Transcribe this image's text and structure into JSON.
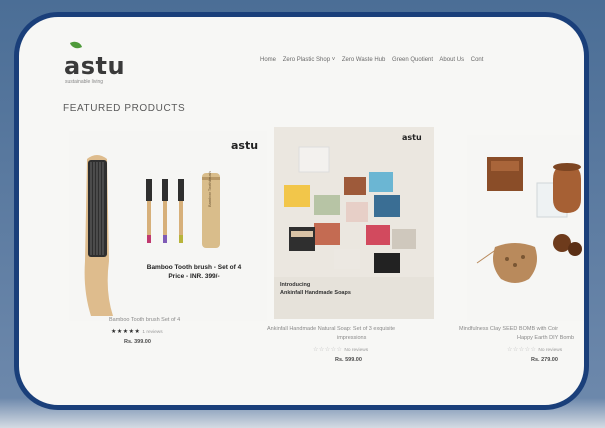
{
  "header": {
    "logo": "astu",
    "logo_sub": "sustainable living",
    "nav": [
      "Home",
      "Zero Plastic Shop ˅",
      "Zero Waste Hub",
      "Green Quotient",
      "About Us",
      "Cont"
    ]
  },
  "featured_title": "FEATURED PRODUCTS",
  "products": [
    {
      "brand": "astu",
      "overlay": "Bamboo Tooth brush - Set of 4\nPrice - INR. 399/-",
      "tube_label": "Bamboo Toothbrush",
      "name": "Bamboo Tooth brush Set of 4",
      "stars": "★★★★★",
      "reviews": "1 reviews",
      "price": "Rs. 399.00"
    },
    {
      "brand": "astu",
      "overlay": "Introducing\nAnkinfall Handmade Soaps",
      "name": "Ankinfall Handmade Natural Soap: Set of 3 exquisite",
      "name2": "impressions",
      "stars": "☆☆☆☆☆",
      "reviews": "No reviews",
      "price": "Rs. 599.00"
    },
    {
      "name": "Mindfulness Clay SEED BOMB with Coir",
      "name2": "Happy Earth DIY Bomb",
      "stars": "☆☆☆☆☆",
      "reviews": "No reviews",
      "price": "Rs. 279.00"
    }
  ],
  "colors": {
    "frame_border": "#1a3f7a",
    "frame_outer": "#4b6e96",
    "star_filled": "#2b2b2b",
    "star_empty": "#bdbdbd"
  }
}
